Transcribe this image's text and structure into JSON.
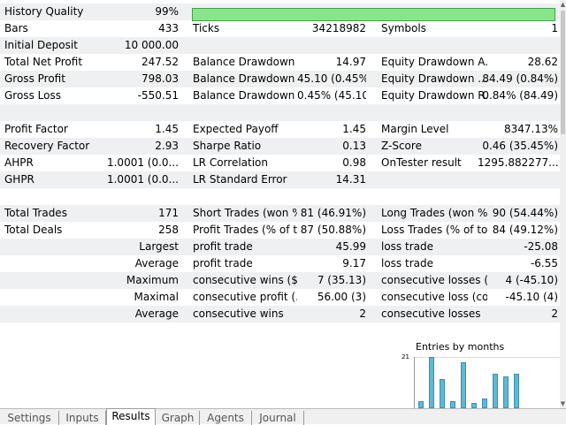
{
  "summary": [
    {
      "label": "History Quality",
      "value": "99%",
      "quality_pct": 99
    },
    {
      "label": "Bars",
      "value": "433",
      "label2": "Ticks",
      "value2": "34218982",
      "label3": "Symbols",
      "value3": "1"
    },
    {
      "label": "Initial Deposit",
      "value": "10 000.00"
    },
    {
      "label": "Total Net Profit",
      "value": "247.52",
      "label2": "Balance Drawdown ...",
      "value2": "14.97",
      "label3": "Equity Drawdown A...",
      "value3": "28.62"
    },
    {
      "label": "Gross Profit",
      "value": "798.03",
      "label2": "Balance Drawdown ...",
      "value2": "45.10 (0.45%)",
      "label3": "Equity Drawdown ...",
      "value3": "84.49 (0.84%)"
    },
    {
      "label": "Gross Loss",
      "value": "-550.51",
      "label2": "Balance Drawdown ...",
      "value2": "0.45% (45.10)",
      "label3": "Equity Drawdown R...",
      "value3": "0.84% (84.49)"
    }
  ],
  "ratios": [
    {
      "label": "Profit Factor",
      "value": "1.45",
      "label2": "Expected Payoff",
      "value2": "1.45",
      "label3": "Margin Level",
      "value3": "8347.13%"
    },
    {
      "label": "Recovery Factor",
      "value": "2.93",
      "label2": "Sharpe Ratio",
      "value2": "0.13",
      "label3": "Z-Score",
      "value3": "0.46 (35.45%)"
    },
    {
      "label": "AHPR",
      "value": "1.0001 (0.0...",
      "label2": "LR Correlation",
      "value2": "0.98",
      "label3": "OnTester result",
      "value3": "1295.882277..."
    },
    {
      "label": "GHPR",
      "value": "1.0001 (0.0...",
      "label2": "LR Standard Error",
      "value2": "14.31"
    }
  ],
  "trades": [
    {
      "label": "Total Trades",
      "value": "171",
      "label2": "Short Trades (won %)",
      "value2": "81 (46.91%)",
      "label3": "Long Trades (won %)",
      "value3": "90 (54.44%)"
    },
    {
      "label": "Total Deals",
      "value": "258",
      "label2": "Profit Trades (% of t...",
      "value2": "87 (50.88%)",
      "label3": "Loss Trades (% of to...",
      "value3": "84 (49.12%)"
    }
  ],
  "details": [
    {
      "label": "Largest",
      "label2": "profit trade",
      "value2": "45.99",
      "label3": "loss trade",
      "value3": "-25.08"
    },
    {
      "label": "Average",
      "label2": "profit trade",
      "value2": "9.17",
      "label3": "loss trade",
      "value3": "-6.55"
    },
    {
      "label": "Maximum",
      "label2": "consecutive wins ($)",
      "value2": "7 (35.13)",
      "label3": "consecutive losses ($)",
      "value3": "4 (-45.10)"
    },
    {
      "label": "Maximal",
      "label2": "consecutive profit (...",
      "value2": "56.00 (3)",
      "label3": "consecutive loss (co...",
      "value3": "-45.10 (4)"
    },
    {
      "label": "Average",
      "label2": "consecutive wins",
      "value2": "2",
      "label3": "consecutive losses",
      "value3": "2"
    }
  ],
  "chart": {
    "title": "Entries by months",
    "y_tick": "21",
    "bar_values": [
      3,
      21,
      12,
      3,
      19,
      2,
      4,
      14,
      13,
      14
    ],
    "ylim": [
      0,
      21
    ],
    "bar_color": "#5fb8d4"
  },
  "tabs": [
    {
      "label": "Settings",
      "active": false
    },
    {
      "label": "Inputs",
      "active": false
    },
    {
      "label": "Results",
      "active": true
    },
    {
      "label": "Graph",
      "active": false
    },
    {
      "label": "Agents",
      "active": false
    },
    {
      "label": "Journal",
      "active": false
    }
  ]
}
